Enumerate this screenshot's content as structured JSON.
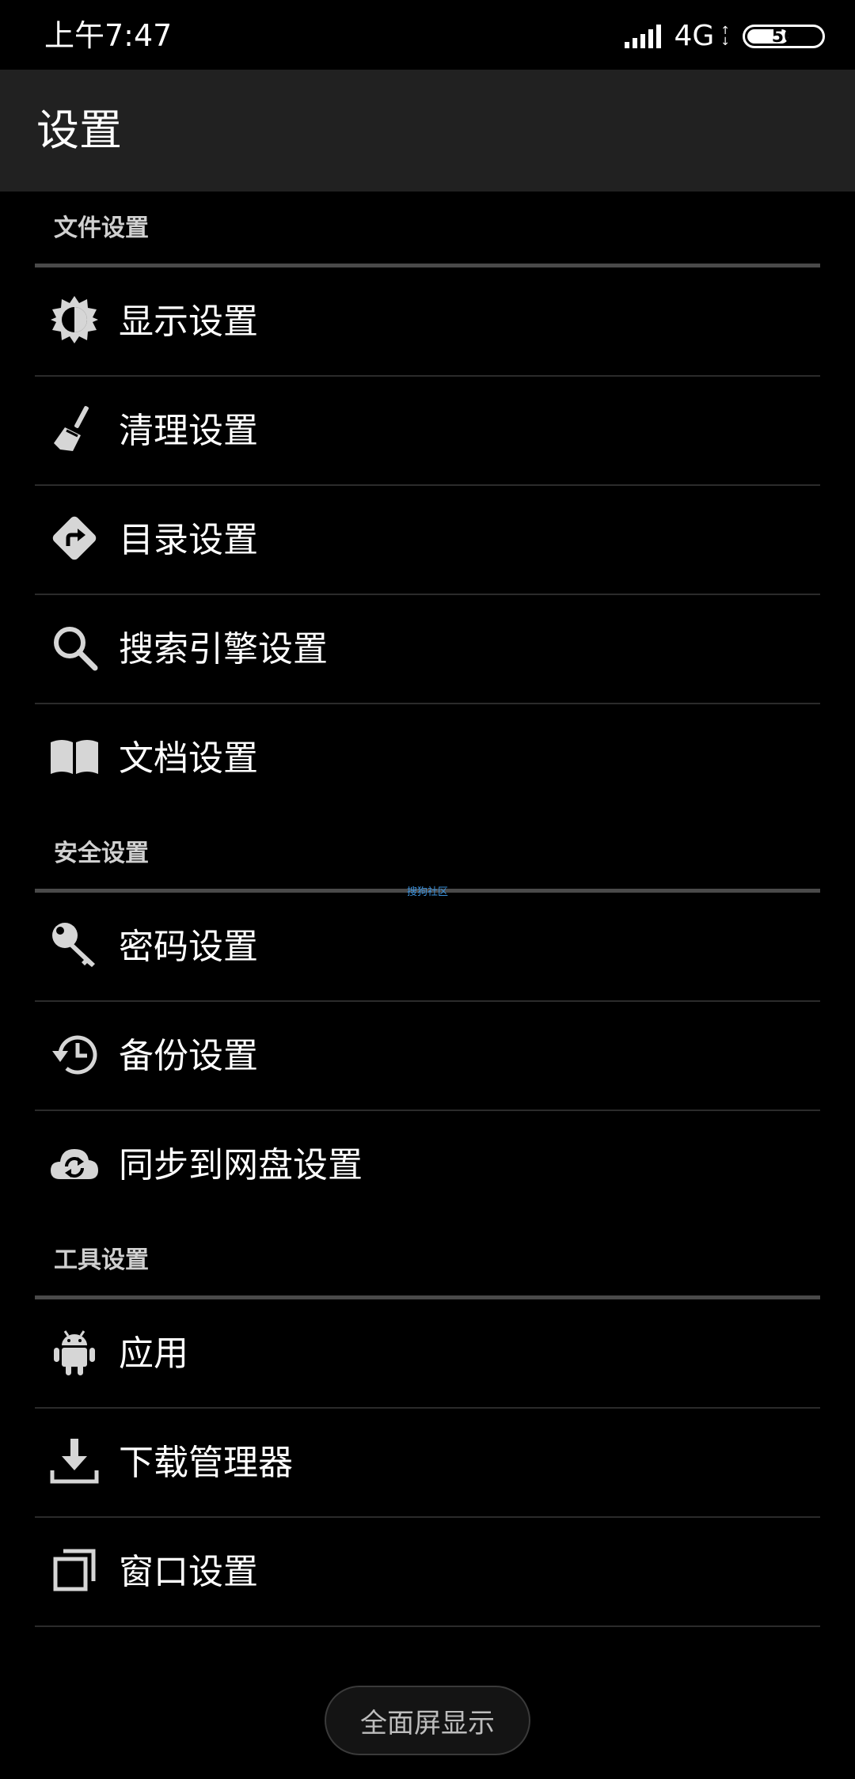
{
  "status": {
    "time": "上午7:47",
    "network": "4G",
    "battery": "56",
    "battery_level_percent": 56
  },
  "app": {
    "title": "设置"
  },
  "sections": {
    "file": {
      "header": "文件设置",
      "items": [
        {
          "label": "显示设置",
          "icon": "brightness-icon"
        },
        {
          "label": "清理设置",
          "icon": "broom-icon"
        },
        {
          "label": "目录设置",
          "icon": "directions-icon"
        },
        {
          "label": "搜索引擎设置",
          "icon": "search-icon"
        },
        {
          "label": "文档设置",
          "icon": "book-icon"
        }
      ]
    },
    "security": {
      "header": "安全设置",
      "items": [
        {
          "label": "密码设置",
          "icon": "key-icon"
        },
        {
          "label": "备份设置",
          "icon": "history-icon"
        },
        {
          "label": "同步到网盘设置",
          "icon": "cloud-sync-icon"
        }
      ]
    },
    "tools": {
      "header": "工具设置",
      "items": [
        {
          "label": "应用",
          "icon": "android-icon"
        },
        {
          "label": "下载管理器",
          "icon": "download-icon"
        },
        {
          "label": "窗口设置",
          "icon": "windows-icon"
        }
      ]
    }
  },
  "watermark": "搜狗社区",
  "fullscreen_button": {
    "label": "全面屏显示"
  },
  "colors": {
    "background": "#000000",
    "appbar": "#212121",
    "icon": "#d6d6d6",
    "section_header_text": "#d0d0d0",
    "section_divider": "#4a4a4a",
    "item_divider": "#2b2b2b"
  }
}
